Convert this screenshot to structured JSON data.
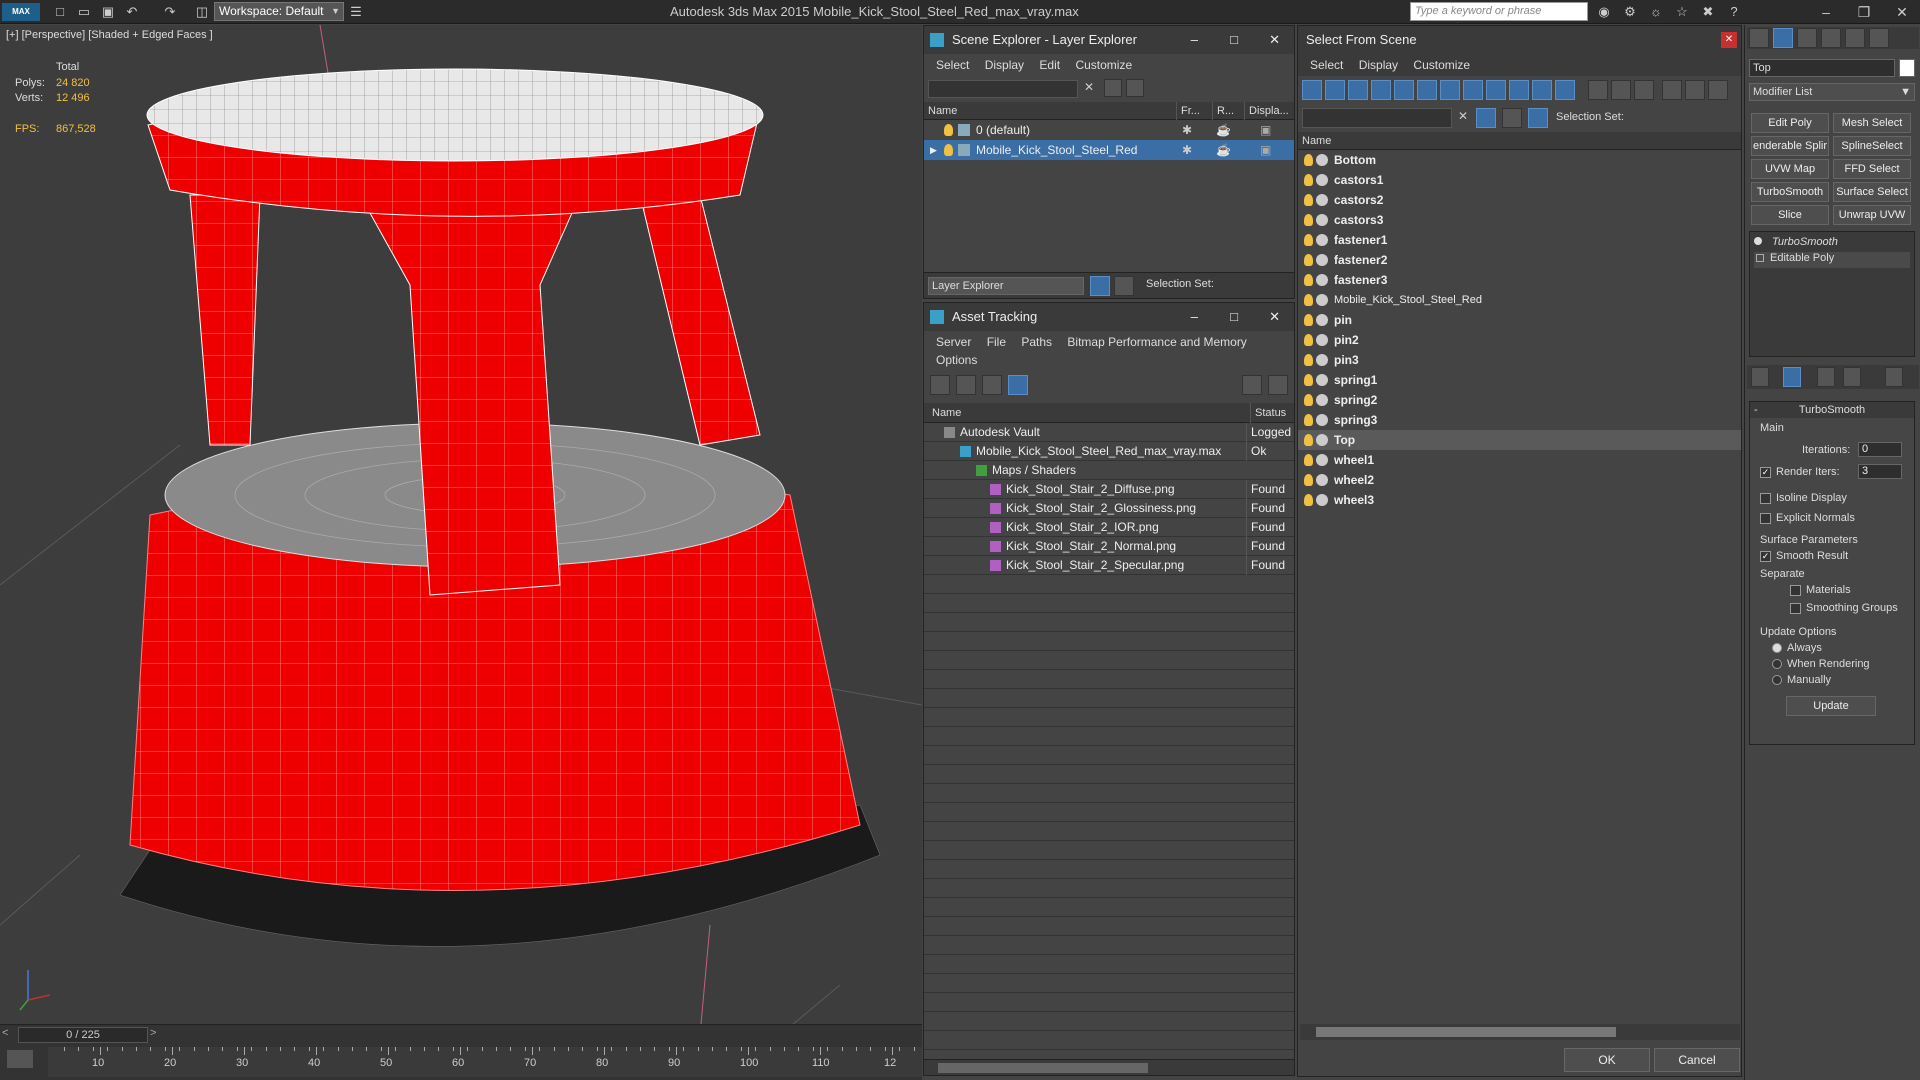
{
  "app": {
    "title": "Autodesk 3ds Max  2015      Mobile_Kick_Stool_Steel_Red_max_vray.max",
    "logo": "MAX",
    "workspace": "Workspace: Default",
    "search_placeholder": "Type a keyword or phrase"
  },
  "viewport": {
    "label": "[+] [Perspective] [Shaded + Edged Faces ]",
    "stats": {
      "total_label": "Total",
      "polys_label": "Polys:",
      "polys": "24 820",
      "verts_label": "Verts:",
      "verts": "12 496",
      "fps_label": "FPS:",
      "fps": "867,528"
    }
  },
  "timeline": {
    "frame": "0 / 225",
    "ticks": [
      "10",
      "20",
      "30",
      "40",
      "50",
      "60",
      "70",
      "80",
      "90",
      "100",
      "110",
      "12"
    ]
  },
  "scene_explorer": {
    "title": "Scene Explorer - Layer Explorer",
    "menu": [
      "Select",
      "Display",
      "Edit",
      "Customize"
    ],
    "columns": {
      "name": "Name",
      "frozen": "Fr...",
      "render": "R...",
      "display": "Displa..."
    },
    "rows": [
      {
        "name": "0 (default)",
        "selected": false
      },
      {
        "name": "Mobile_Kick_Stool_Steel_Red",
        "selected": true
      }
    ],
    "footer_dropdown": "Layer Explorer",
    "selection_set_label": "Selection Set:"
  },
  "asset_tracking": {
    "title": "Asset Tracking",
    "menu": [
      "Server",
      "File",
      "Paths",
      "Bitmap Performance and Memory"
    ],
    "menu2": [
      "Options"
    ],
    "columns": {
      "name": "Name",
      "status": "Status"
    },
    "rows": [
      {
        "name": "Autodesk Vault",
        "status": "Logged"
      },
      {
        "name": "Mobile_Kick_Stool_Steel_Red_max_vray.max",
        "status": "Ok"
      },
      {
        "name": "Maps / Shaders",
        "status": ""
      },
      {
        "name": "Kick_Stool_Stair_2_Diffuse.png",
        "status": "Found"
      },
      {
        "name": "Kick_Stool_Stair_2_Glossiness.png",
        "status": "Found"
      },
      {
        "name": "Kick_Stool_Stair_2_IOR.png",
        "status": "Found"
      },
      {
        "name": "Kick_Stool_Stair_2_Normal.png",
        "status": "Found"
      },
      {
        "name": "Kick_Stool_Stair_2_Specular.png",
        "status": "Found"
      }
    ]
  },
  "select_from_scene": {
    "title": "Select From Scene",
    "menu": [
      "Select",
      "Display",
      "Customize"
    ],
    "selection_set_label": "Selection Set:",
    "column": "Name",
    "items": [
      {
        "name": "Bottom",
        "bold": true
      },
      {
        "name": "castors1",
        "bold": true
      },
      {
        "name": "castors2",
        "bold": true
      },
      {
        "name": "castors3",
        "bold": true
      },
      {
        "name": "fastener1",
        "bold": true
      },
      {
        "name": "fastener2",
        "bold": true
      },
      {
        "name": "fastener3",
        "bold": true
      },
      {
        "name": "Mobile_Kick_Stool_Steel_Red",
        "bold": false
      },
      {
        "name": "pin",
        "bold": true
      },
      {
        "name": "pin2",
        "bold": true
      },
      {
        "name": "pin3",
        "bold": true
      },
      {
        "name": "spring1",
        "bold": true
      },
      {
        "name": "spring2",
        "bold": true
      },
      {
        "name": "spring3",
        "bold": true
      },
      {
        "name": "Top",
        "bold": true,
        "selected": true
      },
      {
        "name": "wheel1",
        "bold": true
      },
      {
        "name": "wheel2",
        "bold": true
      },
      {
        "name": "wheel3",
        "bold": true
      }
    ],
    "ok": "OK",
    "cancel": "Cancel"
  },
  "command_panel": {
    "object_name": "Top",
    "modifier_list": "Modifier List",
    "buttons": [
      "Edit Poly",
      "Mesh Select",
      "enderable Splir",
      "SplineSelect",
      "UVW Map",
      "FFD Select",
      "TurboSmooth",
      "Surface Select",
      "Slice",
      "Unwrap UVW"
    ],
    "stack": [
      "TurboSmooth",
      "Editable Poly"
    ],
    "rollout": {
      "title": "TurboSmooth",
      "main": "Main",
      "iterations_label": "Iterations:",
      "iterations": "0",
      "render_iters_label": "Render Iters:",
      "render_iters": "3",
      "isoline": "Isoline Display",
      "explicit": "Explicit Normals",
      "surface_params": "Surface Parameters",
      "smooth_result": "Smooth Result",
      "separate": "Separate",
      "materials": "Materials",
      "smoothing_groups": "Smoothing Groups",
      "update_options": "Update Options",
      "always": "Always",
      "when_rendering": "When Rendering",
      "manually": "Manually",
      "update": "Update"
    }
  }
}
